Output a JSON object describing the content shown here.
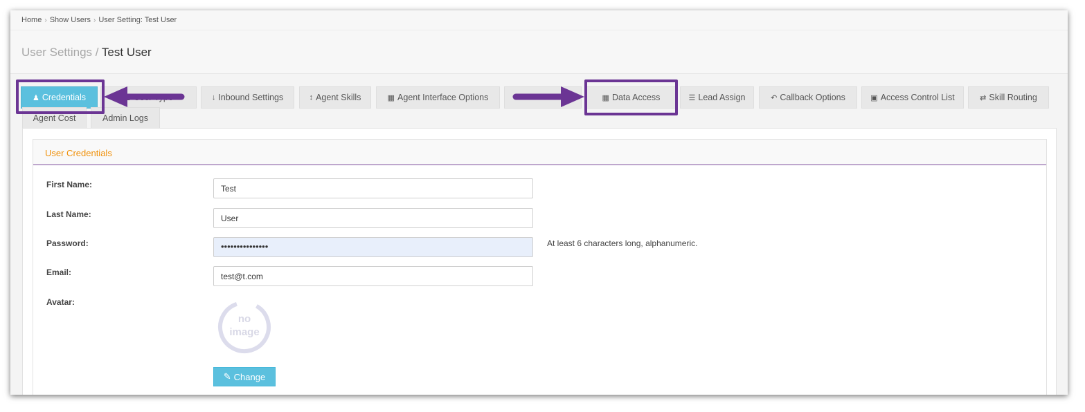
{
  "breadcrumb": {
    "home": "Home",
    "users": "Show Users",
    "current": "User Setting: Test User"
  },
  "title": {
    "section": "User Settings /",
    "name": "Test User"
  },
  "tabs": {
    "credentials": "Credentials",
    "user_type": "User Type",
    "inbound": "Inbound Settings",
    "skills": "Agent Skills",
    "interface": "Agent Interface Options",
    "data_access": "Data Access",
    "lead_assign": "Lead Assign",
    "callback": "Callback Options",
    "acl": "Access Control List",
    "skill_routing": "Skill Routing",
    "agent_cost": "Agent Cost",
    "admin_logs": "Admin Logs"
  },
  "panel": {
    "title": "User Credentials",
    "first_name_label": "First Name:",
    "first_name_value": "Test",
    "last_name_label": "Last Name:",
    "last_name_value": "User",
    "password_label": "Password:",
    "password_value": "•••••••••••••••",
    "password_help": "At least 6 characters long, alphanumeric.",
    "email_label": "Email:",
    "email_value": "test@t.com",
    "avatar_label": "Avatar:",
    "avatar_placeholder_line1": "no",
    "avatar_placeholder_line2": "image",
    "change_button": "Change"
  },
  "colors": {
    "accent": "#5bc0de",
    "highlight": "#6b3594",
    "panel_title": "#f0910a"
  }
}
